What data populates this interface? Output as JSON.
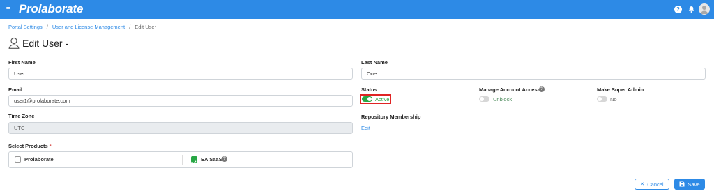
{
  "header": {
    "menu_icon": "hamburger-icon",
    "logo": "Prolaborate",
    "help_icon": "help-icon",
    "bell_icon": "bell-icon",
    "avatar_icon": "user-avatar-icon",
    "bar_color": "#2d8ae6"
  },
  "breadcrumb": {
    "items": [
      "Portal Settings",
      "User and License Management",
      "Edit User"
    ],
    "separator": "/"
  },
  "page": {
    "title": "Edit User -",
    "title_icon": "user-outline-icon"
  },
  "form": {
    "first_name": {
      "label": "First Name",
      "value": "User"
    },
    "last_name": {
      "label": "Last Name",
      "value": "One"
    },
    "email": {
      "label": "Email",
      "value": "user1@prolaborate.com"
    },
    "time_zone": {
      "label": "Time Zone",
      "value": "UTC"
    },
    "status": {
      "label": "Status",
      "toggle_text": "Active",
      "on": true
    },
    "manage_access": {
      "label": "Manage Account Access",
      "toggle_text": "Unblock",
      "on": false
    },
    "super_admin": {
      "label": "Make Super Admin",
      "toggle_text": "No",
      "on": false
    },
    "repository": {
      "label": "Repository Membership",
      "link": "Edit"
    },
    "products": {
      "label": "Select Products",
      "required_mark": "*",
      "options": [
        {
          "label": "Prolaborate",
          "checked": false
        },
        {
          "label": "EA SaaS",
          "checked": true
        }
      ]
    }
  },
  "actions": {
    "cancel": "Cancel",
    "save": "Save"
  },
  "colors": {
    "accent": "#2d8ae6",
    "active": "#28a745",
    "highlight": "#e02424"
  }
}
